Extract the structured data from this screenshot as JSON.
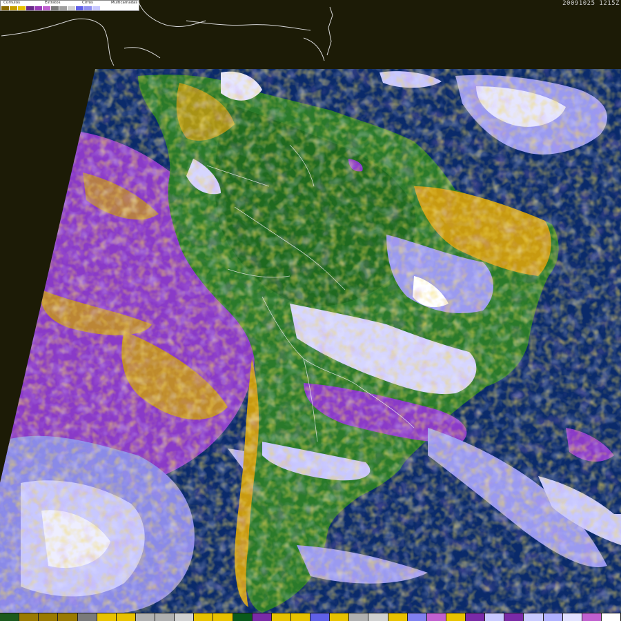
{
  "legend": {
    "labels": {
      "cumulos": "Cúmulos",
      "estratos": "Estratos",
      "cirros": "Cirros",
      "multicamadas": "Multicamadas"
    },
    "colors": [
      "#8b6b00",
      "#c8a000",
      "#e8c200",
      "#6a2a8a",
      "#9a3ab8",
      "#c060d0",
      "#7a7a7a",
      "#a0a0a0",
      "#d0d0d0",
      "#6060e8",
      "#9090f0",
      "#c8c8ff"
    ]
  },
  "timestamp": "20091025 1215Z",
  "bottom_bar": {
    "colors": [
      "#1c5a1c",
      "#9a7a00",
      "#9a7a00",
      "#9a7a00",
      "#7a7a7a",
      "#e8c200",
      "#e8c200",
      "#b0b0b0",
      "#b0b0b0",
      "#d0d0d0",
      "#e8c200",
      "#e8c200",
      "#0a5a1c",
      "#7a2aa8",
      "#e8c200",
      "#e8c200",
      "#6060e8",
      "#e8c200",
      "#b0b0b0",
      "#d0d0d0",
      "#e8c200",
      "#8080f0",
      "#c060d0",
      "#e8c200",
      "#7a2aa8",
      "#c8c8ff",
      "#7a2aa8",
      "#c8c8ff",
      "#b0b0ff",
      "#e0e0ff",
      "#c060d0",
      "#ffffff"
    ]
  },
  "colors": {
    "background": "#1c1b06",
    "ocean": "#0a2a6a",
    "forest": "#2a7a2a",
    "stratus": "#8a3ac8",
    "cumulus": "#c89a10",
    "cirrus": "#9a9af0",
    "multilayer": "#e6e6ff"
  }
}
